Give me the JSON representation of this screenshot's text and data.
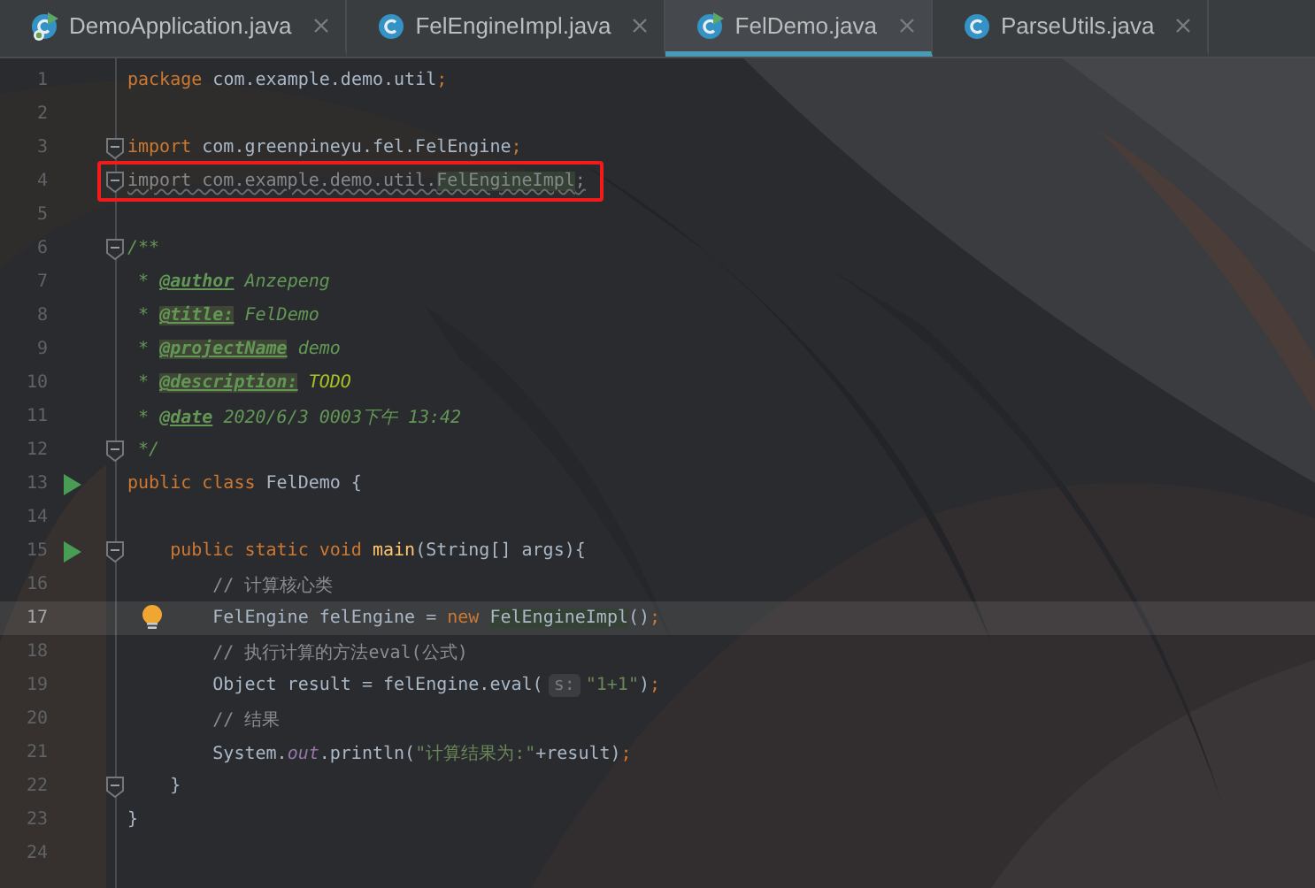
{
  "tabs": [
    {
      "label": "DemoApplication.java",
      "kind": "spring-class",
      "runnable": true,
      "selected": false
    },
    {
      "label": "FelEngineImpl.java",
      "kind": "class",
      "runnable": false,
      "selected": false
    },
    {
      "label": "FelDemo.java",
      "kind": "class",
      "runnable": true,
      "selected": true
    },
    {
      "label": "ParseUtils.java",
      "kind": "class",
      "runnable": false,
      "selected": false
    }
  ],
  "editor": {
    "lines": [
      {
        "number": "1",
        "current": false,
        "highlighted": false,
        "run": false,
        "fold": false,
        "bulb": false,
        "tokens": [
          {
            "kind": "kw",
            "text": "package"
          },
          {
            "kind": "plain",
            "text": " com.example.demo.util"
          },
          {
            "kind": "semi",
            "text": ";"
          }
        ]
      },
      {
        "number": "2",
        "current": false,
        "highlighted": false,
        "run": false,
        "fold": false,
        "bulb": false
      },
      {
        "number": "3",
        "current": false,
        "highlighted": false,
        "run": false,
        "fold": true,
        "bulb": false,
        "tokens": [
          {
            "kind": "kw",
            "text": "import"
          },
          {
            "kind": "plain",
            "text": " com.greenpineyu.fel.FelEngine"
          },
          {
            "kind": "semi",
            "text": ";"
          }
        ]
      },
      {
        "number": "4",
        "current": false,
        "highlighted": true,
        "run": false,
        "fold": true,
        "bulb": false,
        "tokens": [
          {
            "kind": "unused",
            "text": "import com.example.demo.util."
          },
          {
            "kind": "unused-ref",
            "text": "FelEngineImpl"
          },
          {
            "kind": "unused",
            "text": ";"
          }
        ]
      },
      {
        "number": "5",
        "current": false,
        "highlighted": false,
        "run": false,
        "fold": false,
        "bulb": false
      },
      {
        "number": "6",
        "current": false,
        "highlighted": false,
        "run": false,
        "fold": true,
        "bulb": false,
        "tokens": [
          {
            "kind": "doc",
            "text": "/**"
          }
        ]
      },
      {
        "number": "7",
        "current": false,
        "highlighted": false,
        "run": false,
        "fold": false,
        "bulb": false,
        "tokens": [
          {
            "kind": "doc",
            "text": " * "
          },
          {
            "kind": "doctag",
            "text": "@author"
          },
          {
            "kind": "doc",
            "text": " Anzepeng"
          }
        ]
      },
      {
        "number": "8",
        "current": false,
        "highlighted": false,
        "run": false,
        "fold": false,
        "bulb": false,
        "tokens": [
          {
            "kind": "doc",
            "text": " * "
          },
          {
            "kind": "doctag-unknown",
            "text": "@title:"
          },
          {
            "kind": "doc",
            "text": " FelDemo"
          }
        ]
      },
      {
        "number": "9",
        "current": false,
        "highlighted": false,
        "run": false,
        "fold": false,
        "bulb": false,
        "tokens": [
          {
            "kind": "doc",
            "text": " * "
          },
          {
            "kind": "doctag-unknown",
            "text": "@projectName"
          },
          {
            "kind": "doc",
            "text": " demo"
          }
        ]
      },
      {
        "number": "10",
        "current": false,
        "highlighted": false,
        "run": false,
        "fold": false,
        "bulb": false,
        "tokens": [
          {
            "kind": "doc",
            "text": " * "
          },
          {
            "kind": "doctag-unknown",
            "text": "@description:"
          },
          {
            "kind": "todo",
            "text": " TODO"
          }
        ]
      },
      {
        "number": "11",
        "current": false,
        "highlighted": false,
        "run": false,
        "fold": false,
        "bulb": false,
        "tokens": [
          {
            "kind": "doc",
            "text": " * "
          },
          {
            "kind": "doctag",
            "text": "@date"
          },
          {
            "kind": "doc",
            "text": " 2020/6/3 0003下午 13:42"
          }
        ]
      },
      {
        "number": "12",
        "current": false,
        "highlighted": false,
        "run": false,
        "fold": true,
        "bulb": false,
        "tokens": [
          {
            "kind": "doc",
            "text": " */"
          }
        ]
      },
      {
        "number": "13",
        "current": false,
        "highlighted": false,
        "run": true,
        "fold": false,
        "bulb": false,
        "tokens": [
          {
            "kind": "kw",
            "text": "public class"
          },
          {
            "kind": "plain",
            "text": " FelDemo {"
          }
        ]
      },
      {
        "number": "14",
        "current": false,
        "highlighted": false,
        "run": false,
        "fold": false,
        "bulb": false
      },
      {
        "number": "15",
        "current": false,
        "highlighted": false,
        "run": true,
        "fold": true,
        "bulb": false,
        "tokens": [
          {
            "kind": "kw",
            "text": "    public static void"
          },
          {
            "kind": "method",
            "text": " main"
          },
          {
            "kind": "plain",
            "text": "(String[] args){"
          }
        ]
      },
      {
        "number": "16",
        "current": false,
        "highlighted": false,
        "run": false,
        "fold": false,
        "bulb": false,
        "tokens": [
          {
            "kind": "comment",
            "text": "        // 计算核心类"
          }
        ]
      },
      {
        "number": "17",
        "current": true,
        "highlighted": false,
        "run": false,
        "fold": false,
        "bulb": true,
        "tokens": [
          {
            "kind": "plain",
            "text": "        FelEngine felEngine = "
          },
          {
            "kind": "kw",
            "text": "new "
          },
          {
            "kind": "ref",
            "text": "FelEngineImpl"
          },
          {
            "kind": "plain",
            "text": "()"
          },
          {
            "kind": "semi",
            "text": ";"
          }
        ]
      },
      {
        "number": "18",
        "current": false,
        "highlighted": false,
        "run": false,
        "fold": false,
        "bulb": false,
        "tokens": [
          {
            "kind": "comment",
            "text": "        // 执行计算的方法eval(公式)"
          }
        ]
      },
      {
        "number": "19",
        "current": false,
        "highlighted": false,
        "run": false,
        "fold": false,
        "bulb": false,
        "tokens": [
          {
            "kind": "plain",
            "text": "        Object result = felEngine.eval("
          },
          {
            "kind": "hint",
            "text": "s:"
          },
          {
            "kind": "string",
            "text": "\"1+1\""
          },
          {
            "kind": "plain",
            "text": ")"
          },
          {
            "kind": "semi",
            "text": ";"
          }
        ]
      },
      {
        "number": "20",
        "current": false,
        "highlighted": false,
        "run": false,
        "fold": false,
        "bulb": false,
        "tokens": [
          {
            "kind": "comment",
            "text": "        // 结果"
          }
        ]
      },
      {
        "number": "21",
        "current": false,
        "highlighted": false,
        "run": false,
        "fold": false,
        "bulb": false,
        "tokens": [
          {
            "kind": "plain",
            "text": "        System."
          },
          {
            "kind": "field",
            "text": "out"
          },
          {
            "kind": "plain",
            "text": ".println("
          },
          {
            "kind": "string",
            "text": "\"计算结果为:\""
          },
          {
            "kind": "plain",
            "text": "+result)"
          },
          {
            "kind": "semi",
            "text": ";"
          }
        ]
      },
      {
        "number": "22",
        "current": false,
        "highlighted": false,
        "run": false,
        "fold": true,
        "bulb": false,
        "tokens": [
          {
            "kind": "plain",
            "text": "    }"
          }
        ]
      },
      {
        "number": "23",
        "current": false,
        "highlighted": false,
        "run": false,
        "fold": false,
        "bulb": false,
        "tokens": [
          {
            "kind": "plain",
            "text": "}"
          }
        ]
      },
      {
        "number": "24",
        "current": false,
        "highlighted": false,
        "run": false,
        "fold": false,
        "bulb": false
      }
    ]
  }
}
